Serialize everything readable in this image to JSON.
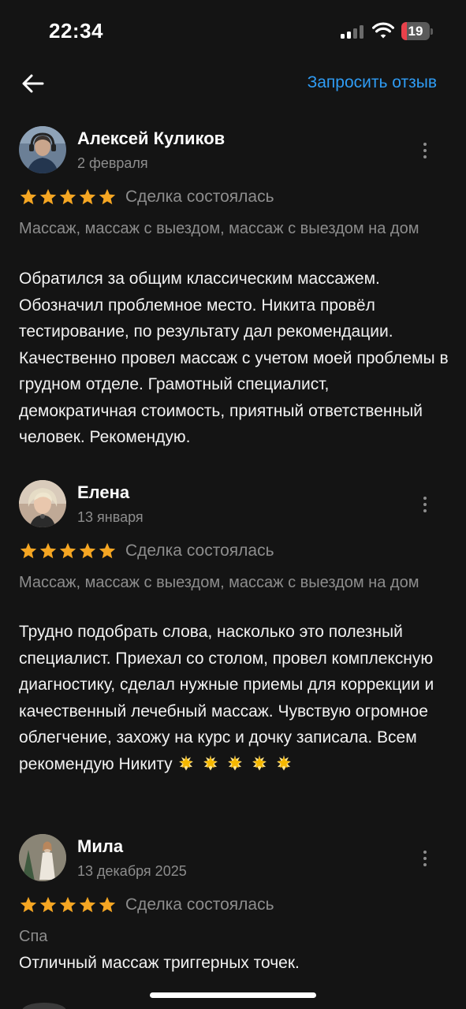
{
  "status_bar": {
    "time": "22:34",
    "battery_level": "19",
    "battery_fill_fraction": 0.19,
    "battery_color": "#e8414b",
    "icons": [
      "signal-icon",
      "wifi-icon",
      "battery-icon"
    ]
  },
  "nav": {
    "back_icon": "arrow-left-icon",
    "request_review_label": "Запросить отзыв",
    "accent_color": "#2f9cf4"
  },
  "reviews": [
    {
      "author": "Алексей Куликов",
      "date": "2 февраля",
      "rating": 5,
      "deal_status": "Сделка состоялась",
      "services": "Массаж, массаж с выездом, массаж с выездом на дом",
      "text": "Обратился за общим классическим массажем. Обозначил проблемное место. Никита провёл тестирование, по результату дал рекомендации. Качественно провел массаж с учетом моей проблемы в грудном отделе. Грамотный специалист, демократичная стоимость, приятный ответственный человек. Рекомендую."
    },
    {
      "author": "Елена",
      "date": "13 января",
      "rating": 5,
      "deal_status": "Сделка состоялась",
      "services": "Массаж, массаж с выездом, массаж с выездом на дом",
      "text": "Трудно подобрать слова, насколько это полезный специалист. Приехал со столом, провел комплексную диагностику, сделал нужные приемы для коррекции и качественный лечебный массаж. Чувствую огромное облегчение, захожу на курс и дочку записала. Всем рекомендую Никиту",
      "trailing_emoji": "🌟🌟🌟🌟🌟"
    },
    {
      "author": "Мила",
      "date": "13 декабря 2025",
      "rating": 5,
      "deal_status": "Сделка состоялась",
      "services": "Спа",
      "text": "Отличный массаж триггерных точек."
    }
  ],
  "colors": {
    "background": "#141414",
    "star": "#f5a623",
    "secondary_text": "#8d8d8d"
  }
}
